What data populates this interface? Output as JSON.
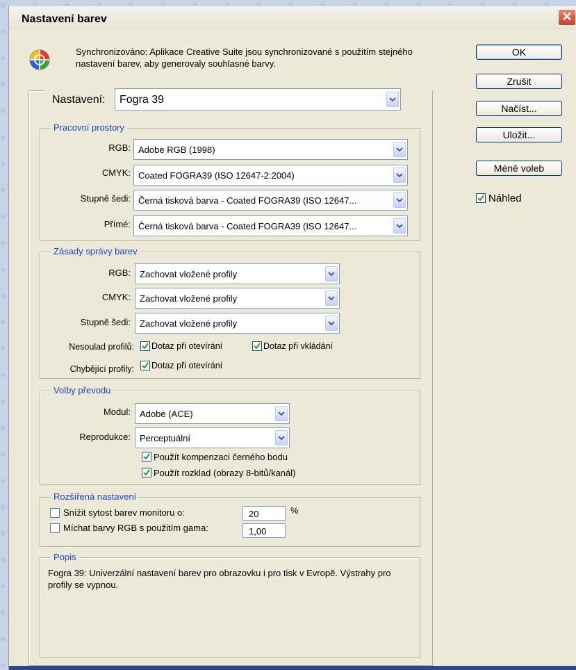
{
  "window": {
    "title": "Nastavení barev"
  },
  "sync_text": "Synchronizováno: Aplikace Creative Suite jsou synchronizované s použitím stejného nastavení barev, aby generovaly souhlasné barvy.",
  "icons": {
    "sync": "color-wheel-icon",
    "close": "close-icon",
    "dropdown": "chevron-down-icon",
    "checkbox": "checkmark-icon"
  },
  "colors": {
    "accent": "#1c46c4",
    "background": "#ece9d8",
    "close_button": "#c0422a"
  },
  "buttons": {
    "ok": "OK",
    "cancel": "Zrušit",
    "load": "Načíst...",
    "save": "Uložit...",
    "fewer": "Méně voleb"
  },
  "preview": {
    "label": "Náhled",
    "checked": true
  },
  "settings": {
    "label": "Nastavení:",
    "value": "Fogra 39"
  },
  "working_spaces": {
    "legend": "Pracovní prostory",
    "rgb_label": "RGB:",
    "rgb_value": "Adobe RGB (1998)",
    "cmyk_label": "CMYK:",
    "cmyk_value": "Coated FOGRA39 (ISO 12647-2:2004)",
    "gray_label": "Stupně šedi:",
    "gray_value": "Černá tisková barva - Coated FOGRA39 (ISO 12647...",
    "spot_label": "Přímé:",
    "spot_value": "Černá tisková barva - Coated FOGRA39 (ISO 12647..."
  },
  "policies": {
    "legend": "Zásady správy barev",
    "rgb_label": "RGB:",
    "rgb_value": "Zachovat vložené profily",
    "cmyk_label": "CMYK:",
    "cmyk_value": "Zachovat vložené profily",
    "gray_label": "Stupně šedi:",
    "gray_value": "Zachovat vložené profily",
    "mismatch_label": "Nesoulad profilů:",
    "ask_open": "Dotaz při otevírání",
    "ask_paste": "Dotaz při vkládání",
    "missing_label": "Chybějící profily:",
    "ask_open_missing": "Dotaz při otevírání"
  },
  "conversion": {
    "legend": "Volby převodu",
    "engine_label": "Modul:",
    "engine_value": "Adobe (ACE)",
    "intent_label": "Reprodukce:",
    "intent_value": "Perceptuální",
    "bpc": "Použít kompenzaci černého bodu",
    "dither": "Použít rozklad (obrazy 8-bitů/kanál)"
  },
  "advanced": {
    "legend": "Rozšířená nastavení",
    "desaturate": "Snížit sytost barev monitoru o:",
    "desaturate_value": "20",
    "percent": "%",
    "blend": "Míchat barvy RGB s použitím gama:",
    "blend_value": "1,00"
  },
  "description": {
    "legend": "Popis",
    "text": "Fogra 39: Univerzální nastavení barev pro obrazovku i pro tisk v Evropě. Výstrahy pro profily se vypnou."
  }
}
